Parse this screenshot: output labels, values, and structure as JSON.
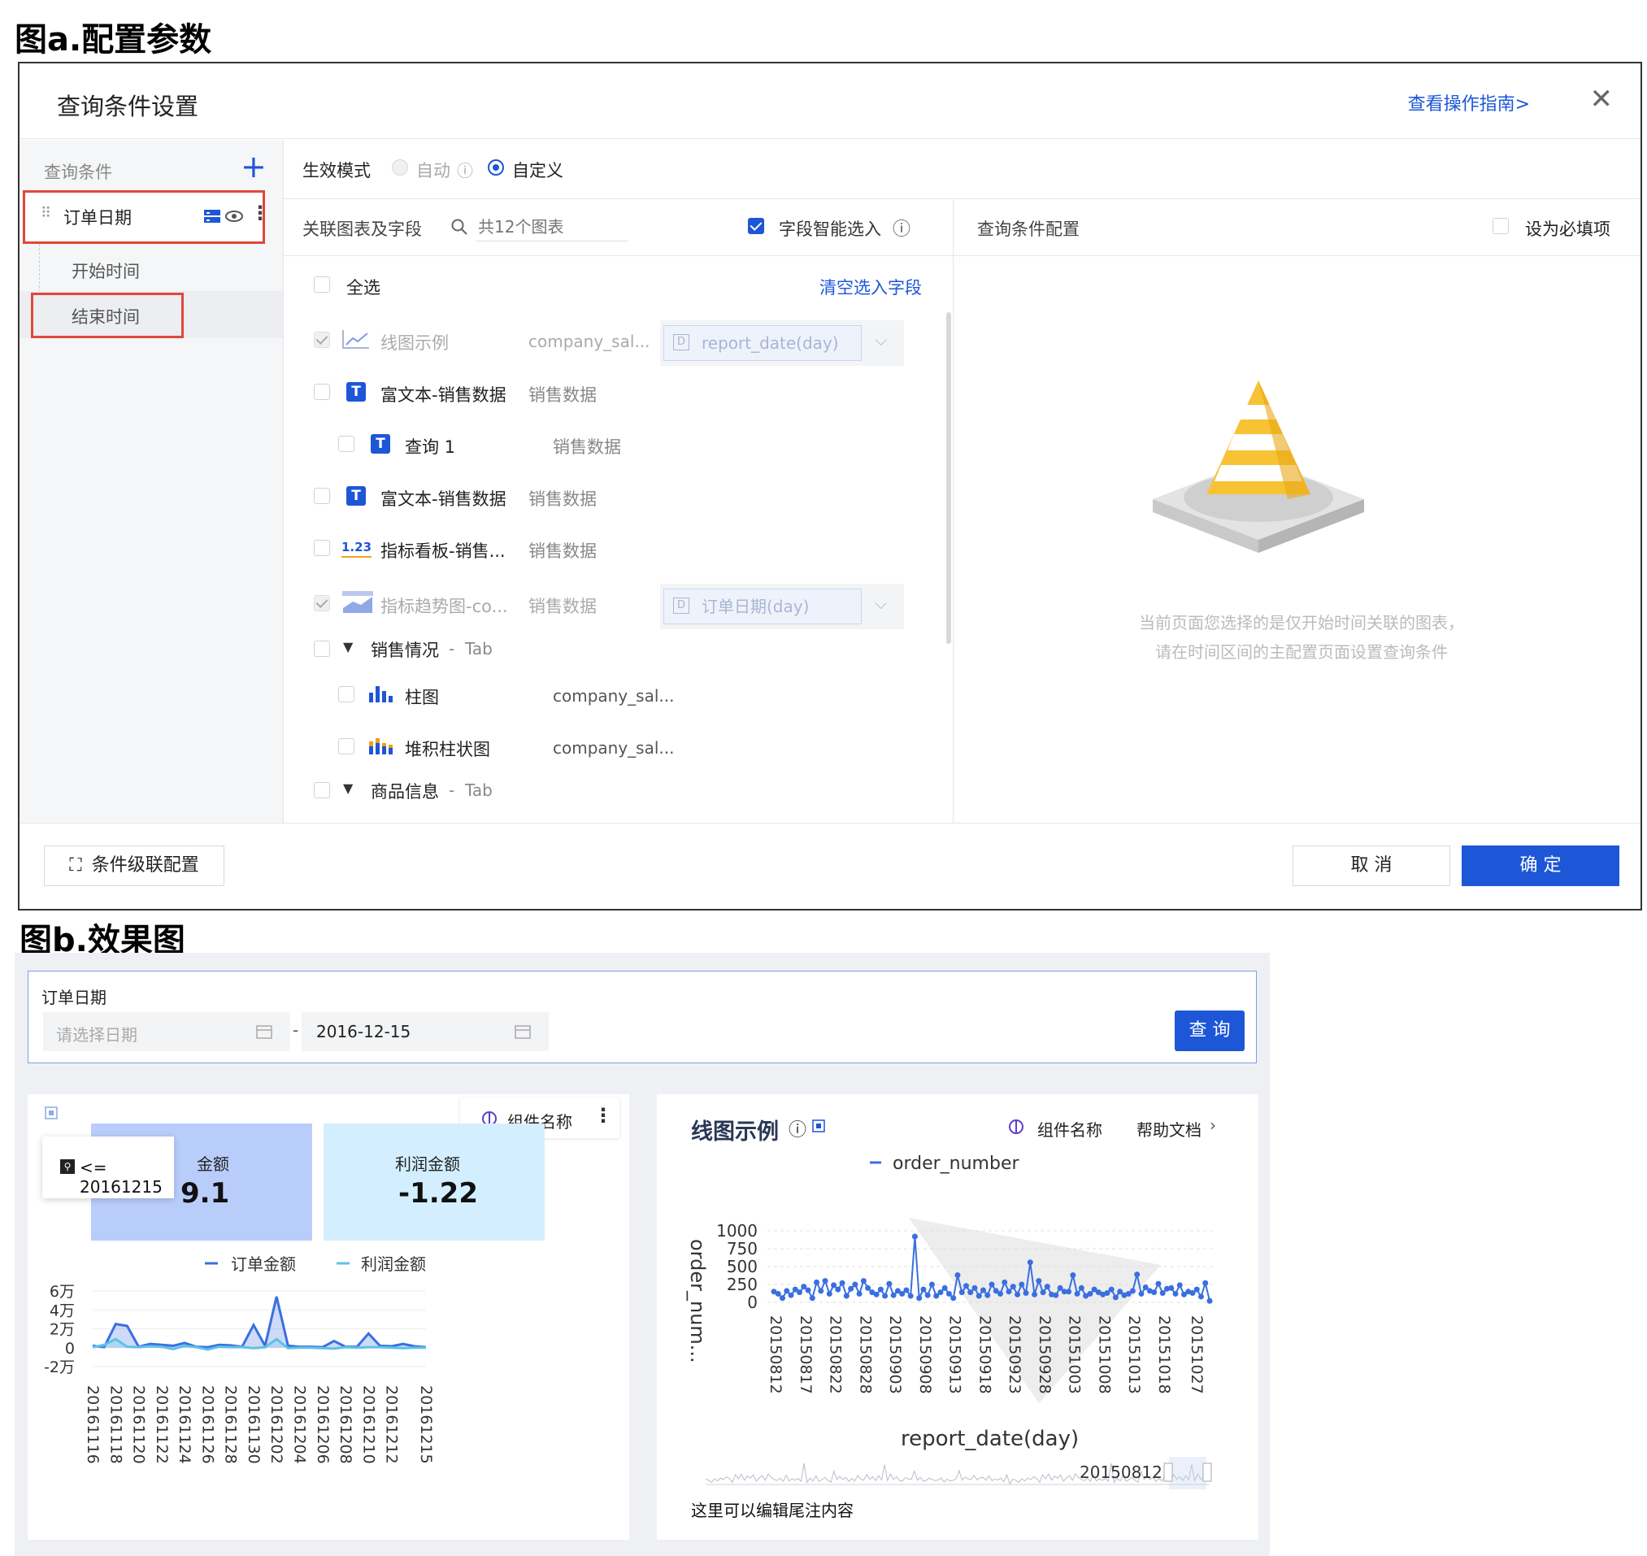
{
  "captions": {
    "fig_a": "图a.配置参数",
    "fig_b": "图b.效果图"
  },
  "dialog": {
    "title": "查询条件设置",
    "guide_link": "查看操作指南>",
    "left": {
      "header": "查询条件",
      "item": "订单日期",
      "sub_start": "开始时间",
      "sub_end": "结束时间"
    },
    "mode": {
      "label": "生效模式",
      "auto": "自动",
      "custom": "自定义",
      "selected": "custom"
    },
    "assoc": {
      "header": "关联图表及字段",
      "search_placeholder": "共12个图表",
      "smart_select": "字段智能选入",
      "select_all": "全选",
      "clear": "清空选入字段",
      "rows": [
        {
          "name": "线图示例",
          "ds": "company_sal...",
          "field": "report_date(day)",
          "checked": true,
          "disabled": true,
          "icon": "line-chart-icon"
        },
        {
          "name": "富文本-销售数据",
          "ds": "销售数据",
          "field": "",
          "icon": "text-icon"
        },
        {
          "name": "查询 1",
          "ds": "销售数据",
          "field": "",
          "icon": "text-icon"
        },
        {
          "name": "富文本-销售数据",
          "ds": "销售数据",
          "field": "",
          "icon": "text-icon"
        },
        {
          "name": "指标看板-销售...",
          "ds": "销售数据",
          "field": "",
          "icon": "kpi-icon"
        },
        {
          "name": "指标趋势图-co...",
          "ds": "销售数据",
          "field": "订单日期(day)",
          "checked": true,
          "disabled": true,
          "icon": "trend-chart-icon"
        },
        {
          "name": "销售情况",
          "suffix": "Tab",
          "group": true
        },
        {
          "name": "柱图",
          "ds": "company_sal...",
          "icon": "bar-chart-icon"
        },
        {
          "name": "堆积柱状图",
          "ds": "company_sal...",
          "icon": "stacked-bar-icon"
        },
        {
          "name": "商品信息",
          "suffix": "Tab",
          "group": true
        }
      ]
    },
    "config": {
      "header": "查询条件配置",
      "required": "设为必填项",
      "empty_text": "当前页面您选择的是仅开始时间关联的图表，请在时间区间的主配置页面设置查询条件"
    },
    "footer": {
      "cascade": "条件级联配置",
      "cancel": "取 消",
      "ok": "确 定"
    }
  },
  "effect": {
    "filter": {
      "label": "订单日期",
      "start_placeholder": "请选择日期",
      "end_value": "2016-12-15",
      "dash": "-",
      "query_btn": "查 询"
    },
    "left_card": {
      "component_name": "组件名称",
      "kpi1_label": "金额",
      "kpi1_value": "9.1",
      "kpi2_label": "利润金额",
      "kpi2_value": "-1.22",
      "tooltip": "<= 20161215",
      "legend1": "订单金额",
      "legend2": "利润金额",
      "accent1": "#3a6fe0",
      "accent2": "#5ec1e8"
    },
    "right_card": {
      "title": "线图示例",
      "component_name": "组件名称",
      "help": "帮助文档",
      "legend": "order_number",
      "ylabel": "order_num...",
      "xlabel": "report_date(day)",
      "slider_label": "20150812",
      "footnote": "这里可以编辑尾注内容"
    }
  },
  "chart_data": [
    {
      "type": "area",
      "title": "",
      "categories": [
        "20161116",
        "20161117",
        "20161118",
        "20161119",
        "20161120",
        "20161121",
        "20161122",
        "20161123",
        "20161124",
        "20161125",
        "20161126",
        "20161127",
        "20161128",
        "20161129",
        "20161130",
        "20161201",
        "20161202",
        "20161203",
        "20161204",
        "20161205",
        "20161206",
        "20161207",
        "20161208",
        "20161209",
        "20161210",
        "20161211",
        "20161212",
        "20161213",
        "20161214",
        "20161215"
      ],
      "tick_labels": [
        "20161116",
        "20161118",
        "20161120",
        "20161122",
        "20161124",
        "20161126",
        "20161128",
        "20161130",
        "20161202",
        "20161204",
        "20161206",
        "20161208",
        "20161210",
        "20161212",
        "20161215"
      ],
      "series": [
        {
          "name": "订单金额",
          "values": [
            2000,
            500,
            25000,
            23000,
            1000,
            4000,
            3000,
            2000,
            5000,
            1000,
            500,
            3000,
            2500,
            1000,
            24000,
            2000,
            54000,
            2000,
            1000,
            1000,
            500,
            7000,
            1000,
            1000,
            15000,
            2000,
            1500,
            4000,
            1500,
            500
          ]
        },
        {
          "name": "利润金额",
          "values": [
            500,
            3000,
            9000,
            1000,
            500,
            1500,
            1000,
            -1500,
            2000,
            500,
            -2000,
            1000,
            500,
            500,
            -500,
            500,
            9000,
            -500,
            0,
            0,
            -500,
            -1000,
            500,
            0,
            500,
            500,
            0,
            -500,
            0,
            0
          ]
        }
      ],
      "yticks": [
        "6万",
        "4万",
        "2万",
        "0",
        "-2万"
      ],
      "ylim": [
        -20000,
        60000
      ]
    },
    {
      "type": "line",
      "title": "线图示例",
      "xlabel": "report_date(day)",
      "ylabel": "order_num...",
      "x_ticks": [
        "20150812",
        "20150817",
        "20150822",
        "20150828",
        "20150903",
        "20150908",
        "20150913",
        "20150918",
        "20150923",
        "20150928",
        "20151003",
        "20151008",
        "20151013",
        "20151018",
        "20151027"
      ],
      "ylim": [
        0,
        1000
      ],
      "yticks": [
        0,
        250,
        500,
        750,
        1000
      ],
      "series": [
        {
          "name": "order_number",
          "values": [
            150,
            120,
            60,
            160,
            100,
            180,
            140,
            220,
            170,
            60,
            280,
            160,
            300,
            120,
            240,
            180,
            270,
            90,
            190,
            250,
            120,
            300,
            200,
            140,
            110,
            180,
            90,
            260,
            100,
            160,
            120,
            170,
            90,
            920,
            60,
            180,
            100,
            250,
            90,
            140,
            200,
            120,
            60,
            380,
            140,
            230,
            140,
            200,
            90,
            170,
            100,
            250,
            160,
            120,
            280,
            150,
            220,
            110,
            250,
            130,
            560,
            110,
            300,
            140,
            220,
            110,
            100,
            200,
            150,
            150,
            380,
            120,
            200,
            90,
            120,
            180,
            140,
            110,
            130,
            180,
            70,
            150,
            100,
            120,
            160,
            390,
            120,
            210,
            160,
            140,
            260,
            130,
            190,
            200,
            120,
            240,
            110,
            150,
            130,
            180,
            80,
            270,
            20
          ]
        }
      ]
    }
  ]
}
